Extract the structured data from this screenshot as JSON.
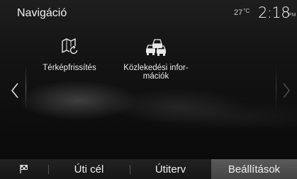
{
  "header": {
    "title": "Navigáció",
    "temperature": "27",
    "temperature_unit": "°C",
    "time": "2:18",
    "ampm": "PM"
  },
  "tiles": [
    {
      "label_line1": "Térképfrissítés",
      "label_line2": "",
      "icon": "map-refresh-icon"
    },
    {
      "label_line1": "Közlekedési infor-",
      "label_line2": "mációk",
      "icon": "traffic-cars-icon"
    }
  ],
  "navigation": {
    "prev_icon": "chevron-left-icon",
    "next_icon": "chevron-right-icon"
  },
  "tabs": {
    "flag_icon": "checkered-flag-icon",
    "destination": "Úti cél",
    "route": "Útiterv",
    "settings": "Beállítások",
    "active": "settings"
  },
  "colors": {
    "background": "#141414",
    "active_tab": "#505050",
    "text": "#ffffff"
  }
}
